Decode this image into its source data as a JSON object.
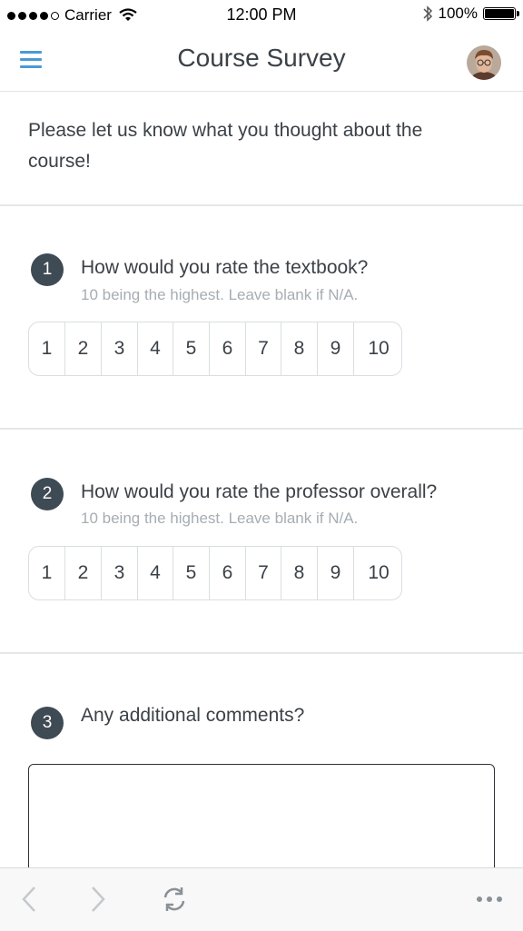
{
  "status_bar": {
    "carrier": "Carrier",
    "time": "12:00 PM",
    "battery": "100%",
    "battery_level": 1.0
  },
  "header": {
    "title": "Course Survey",
    "menu_icon": "hamburger-menu-icon",
    "avatar_icon": "user-avatar"
  },
  "intro": {
    "text": "Please let us know what you thought about the course!"
  },
  "questions": [
    {
      "number": "1",
      "title": "How would you rate the textbook?",
      "hint": "10 being the highest. Leave blank if N/A.",
      "options": [
        "1",
        "2",
        "3",
        "4",
        "5",
        "6",
        "7",
        "8",
        "9",
        "10"
      ]
    },
    {
      "number": "2",
      "title": "How would you rate the professor overall?",
      "hint": "10 being the highest. Leave blank if N/A.",
      "options": [
        "1",
        "2",
        "3",
        "4",
        "5",
        "6",
        "7",
        "8",
        "9",
        "10"
      ]
    },
    {
      "number": "3",
      "title": "Any additional comments?",
      "comment_value": ""
    }
  ],
  "toolbar": {
    "back_icon": "chevron-left-icon",
    "forward_icon": "chevron-right-icon",
    "refresh_icon": "refresh-icon",
    "more_icon": "more-dots-icon"
  },
  "colors": {
    "accent": "#4a9ad6",
    "badge": "#3e4a54",
    "text": "#3b4147",
    "hint": "#a6adb3",
    "border": "#d9dee2"
  }
}
